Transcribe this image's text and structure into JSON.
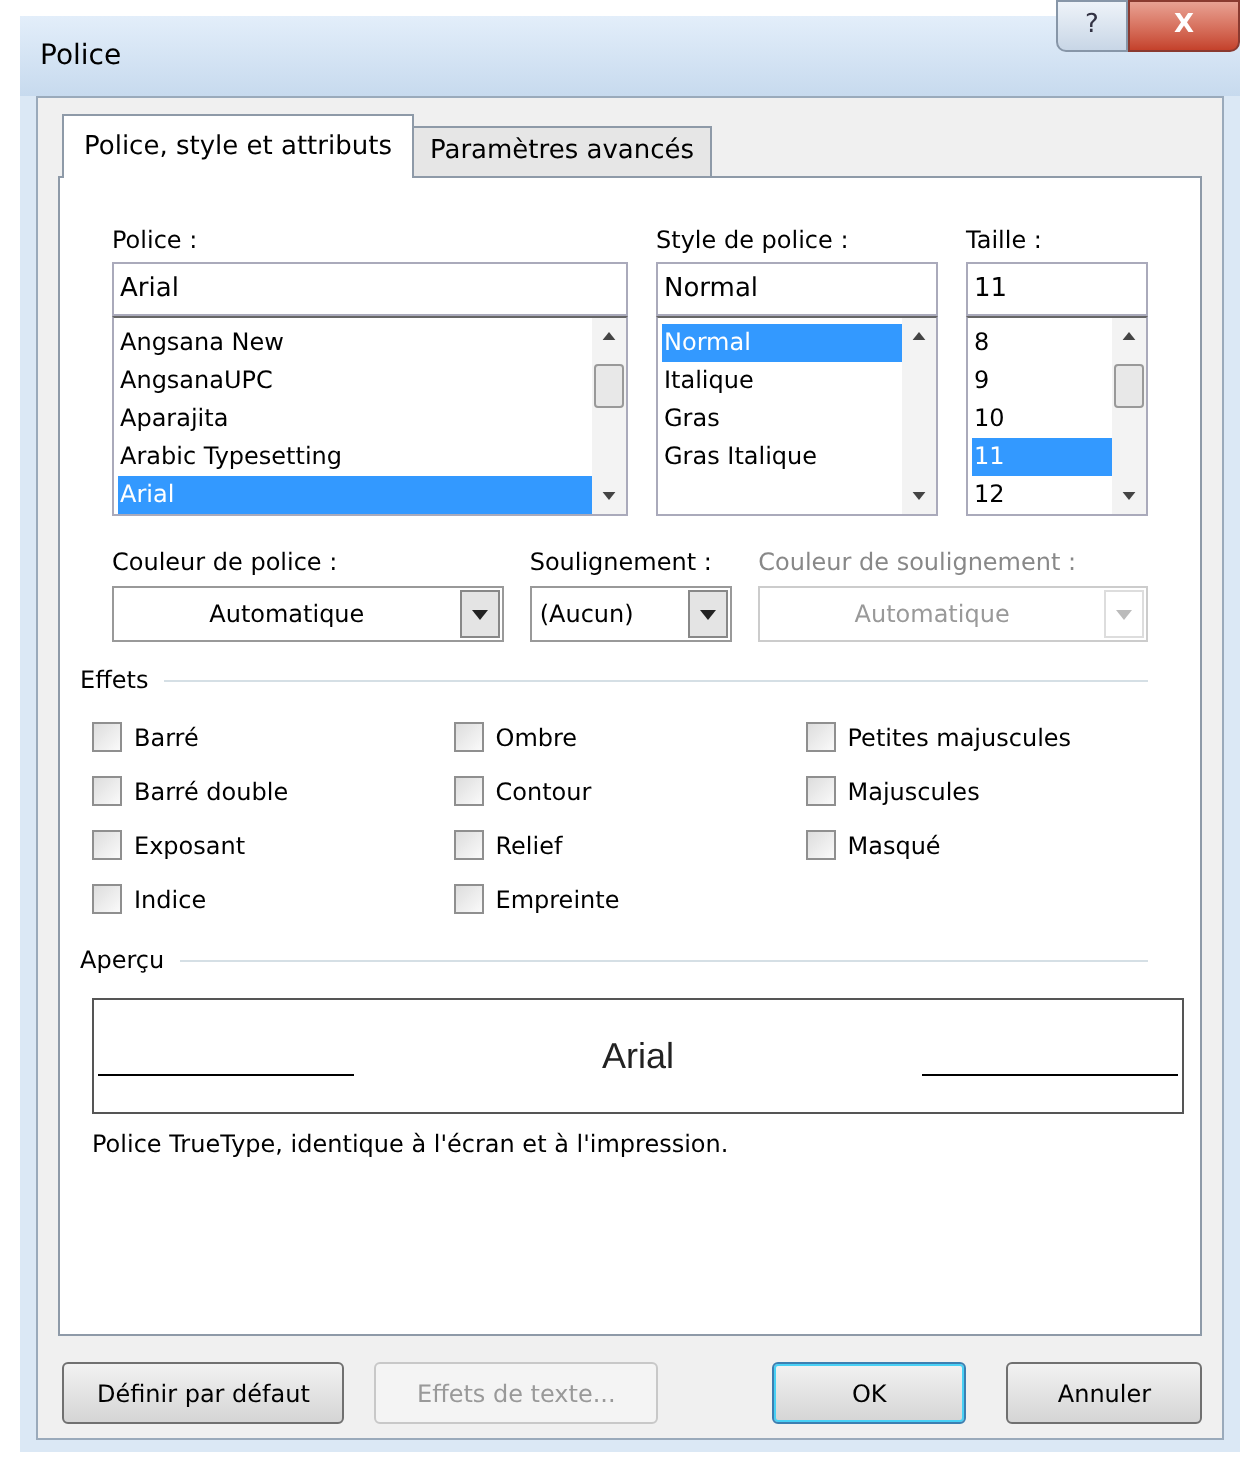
{
  "window": {
    "title": "Police",
    "title_buttons": [
      {
        "kind": "help",
        "label": "?"
      },
      {
        "kind": "close",
        "label": "X"
      }
    ]
  },
  "tabs": [
    {
      "label": "Police, style et attributs",
      "selected": true
    },
    {
      "label": "Paramètres avancés",
      "selected": false
    }
  ],
  "font": {
    "label": "Police :",
    "value": "Arial",
    "items": [
      {
        "label": "Angsana New",
        "selected": false
      },
      {
        "label": "AngsanaUPC",
        "selected": false
      },
      {
        "label": "Aparajita",
        "selected": false
      },
      {
        "label": "Arabic Typesetting",
        "selected": false
      },
      {
        "label": "Arial",
        "selected": true
      }
    ]
  },
  "style": {
    "label": "Style de police :",
    "value": "Normal",
    "items": [
      {
        "label": "Normal",
        "selected": true
      },
      {
        "label": "Italique",
        "selected": false
      },
      {
        "label": "Gras",
        "selected": false
      },
      {
        "label": "Gras Italique",
        "selected": false
      }
    ]
  },
  "size": {
    "label": "Taille :",
    "value": "11",
    "items": [
      {
        "label": "8",
        "selected": false
      },
      {
        "label": "9",
        "selected": false
      },
      {
        "label": "10",
        "selected": false
      },
      {
        "label": "11",
        "selected": true
      },
      {
        "label": "12",
        "selected": false
      }
    ]
  },
  "dropdowns": [
    {
      "label": "Couleur de police :",
      "value": "Automatique",
      "disabled": false,
      "centered": true
    },
    {
      "label": "Soulignement :",
      "value": "(Aucun)",
      "disabled": false,
      "centered": false
    },
    {
      "label": "Couleur de soulignement :",
      "value": "Automatique",
      "disabled": true,
      "centered": true
    }
  ],
  "effects": {
    "title": "Effets",
    "columns": [
      [
        {
          "label": "Barré",
          "checked": false
        },
        {
          "label": "Barré double",
          "checked": false
        },
        {
          "label": "Exposant",
          "checked": false
        },
        {
          "label": "Indice",
          "checked": false
        }
      ],
      [
        {
          "label": "Ombre",
          "checked": false
        },
        {
          "label": "Contour",
          "checked": false
        },
        {
          "label": "Relief",
          "checked": false
        },
        {
          "label": "Empreinte",
          "checked": false
        }
      ],
      [
        {
          "label": "Petites majuscules",
          "checked": false
        },
        {
          "label": "Majuscules",
          "checked": false
        },
        {
          "label": "Masqué",
          "checked": false
        }
      ]
    ]
  },
  "preview": {
    "title": "Aperçu",
    "sample": "Arial",
    "description": "Police TrueType, identique à l'écran et à l'impression."
  },
  "buttons": [
    {
      "label": "Définir par défaut",
      "disabled": false,
      "default": false
    },
    {
      "label": "Effets de texte...",
      "disabled": true,
      "default": false
    },
    {
      "label": "OK",
      "disabled": false,
      "default": true
    },
    {
      "label": "Annuler",
      "disabled": false,
      "default": false
    }
  ]
}
